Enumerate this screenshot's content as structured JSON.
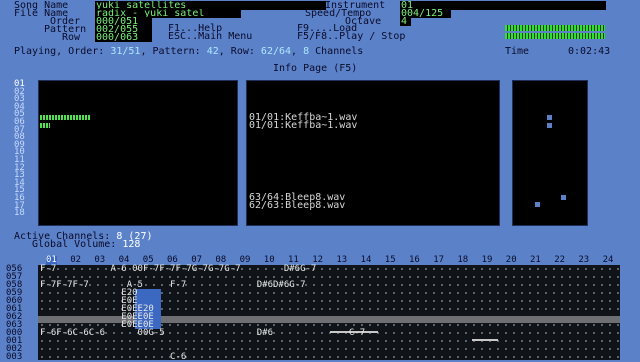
{
  "header": {
    "song_name_label": "Song Name",
    "song_name": "yuki satellites",
    "file_name_label": "File Name",
    "file_name": "radix - yuki_satel",
    "order_label": "Order",
    "order_value": "000/051",
    "pattern_label": "Pattern",
    "pattern_value": "002/055",
    "row_label": "Row",
    "row_value": "000/063",
    "instrument_label": "Instrument",
    "instrument_value": "01",
    "speed_label": "Speed/Tempo",
    "speed_value": "004/125",
    "octave_label": "Octave",
    "octave_value": "4",
    "help_f1": "F1...Help",
    "help_esc": "ESC..Main Menu",
    "help_f9": "F9....Load",
    "help_f5": "F5/F8..Play / Stop"
  },
  "status": {
    "playing_label": "Playing, Order:",
    "order": "31/51",
    "pattern_label": "Pattern:",
    "pattern": "42",
    "row_label": "Row:",
    "row": "62/64",
    "channels_count": "8",
    "channels_label": "Channels",
    "time_label": "Time",
    "time": "0:02:43"
  },
  "info_title": "Info Page (F5)",
  "channels_list": [
    "01",
    "02",
    "03",
    "04",
    "05",
    "06",
    "07",
    "08",
    "09",
    "10",
    "11",
    "12",
    "13",
    "14",
    "15",
    "16",
    "17",
    "18"
  ],
  "samples": {
    "top": [
      "01/01:Keffba~1.wav",
      "01/01:Keffba~1.wav"
    ],
    "bottom": [
      "63/64:Bleep8.wav",
      "62/63:Bleep8.wav"
    ]
  },
  "active_channels_label": "Active Channels:",
  "active_channels": "8 (27)",
  "global_volume_label": "Global Volume:",
  "global_volume": "128",
  "pattern_channels": [
    "01",
    "02",
    "03",
    "04",
    "05",
    "06",
    "07",
    "08",
    "09",
    "10",
    "11",
    "12",
    "13",
    "14",
    "15",
    "16",
    "17",
    "18",
    "19",
    "20",
    "21",
    "22",
    "23",
    "24"
  ],
  "pattern_rows": [
    {
      "num": "056",
      "text": "F-7          A-6 00F-7F-7F-7G-7G-7G-7        D#6G-7"
    },
    {
      "num": "057",
      "text": ""
    },
    {
      "num": "058",
      "text": "F-7F-7F-7       A-5     F-7             D#6D#6G-7"
    },
    {
      "num": "059",
      "text": "               E20"
    },
    {
      "num": "060",
      "text": "               E0E"
    },
    {
      "num": "061",
      "text": "               E0EE20"
    },
    {
      "num": "062",
      "text": "               E0EE0E"
    },
    {
      "num": "063",
      "text": "               E0EE0E"
    },
    {
      "num": "000",
      "text": "F-6F-6C-6C-6      00G-5                 D#6              C-7"
    },
    {
      "num": "001",
      "text": ""
    },
    {
      "num": "002",
      "text": ""
    },
    {
      "num": "003",
      "text": "                        C-6"
    }
  ],
  "colors": {
    "background": "#5b82c8",
    "panel": "#000000",
    "field_text": "#7cf07a",
    "highlight": "#3b68c0"
  }
}
